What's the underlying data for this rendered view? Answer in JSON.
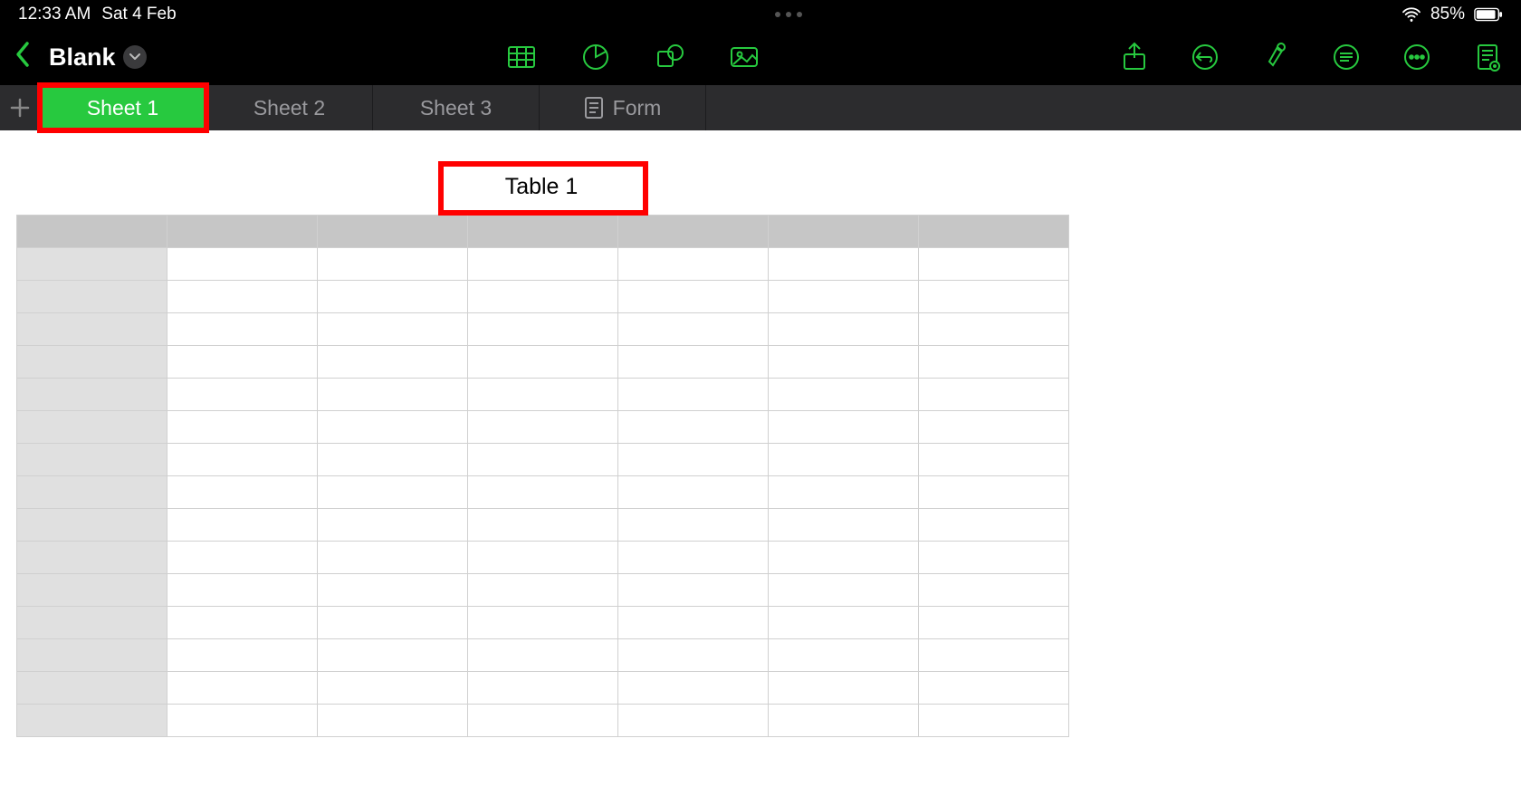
{
  "status_bar": {
    "time": "12:33 AM",
    "date": "Sat 4 Feb",
    "battery_percent": "85%"
  },
  "toolbar": {
    "document_title": "Blank",
    "center_icons": [
      "table-icon",
      "chart-icon",
      "shape-icon",
      "media-icon"
    ],
    "right_icons": [
      "share-icon",
      "undo-icon",
      "collaborate-icon",
      "comments-icon",
      "more-icon",
      "activity-icon"
    ]
  },
  "tabs": {
    "items": [
      {
        "label": "Sheet 1",
        "active": true,
        "highlighted": true,
        "has_form_icon": false
      },
      {
        "label": "Sheet 2",
        "active": false,
        "highlighted": false,
        "has_form_icon": false
      },
      {
        "label": "Sheet 3",
        "active": false,
        "highlighted": false,
        "has_form_icon": false
      },
      {
        "label": "Form",
        "active": false,
        "highlighted": false,
        "has_form_icon": true
      }
    ]
  },
  "table": {
    "title": "Table 1",
    "title_highlighted": true,
    "columns": 7,
    "rows": 15
  },
  "colors": {
    "accent": "#27c93f",
    "highlight": "#ff0000"
  }
}
